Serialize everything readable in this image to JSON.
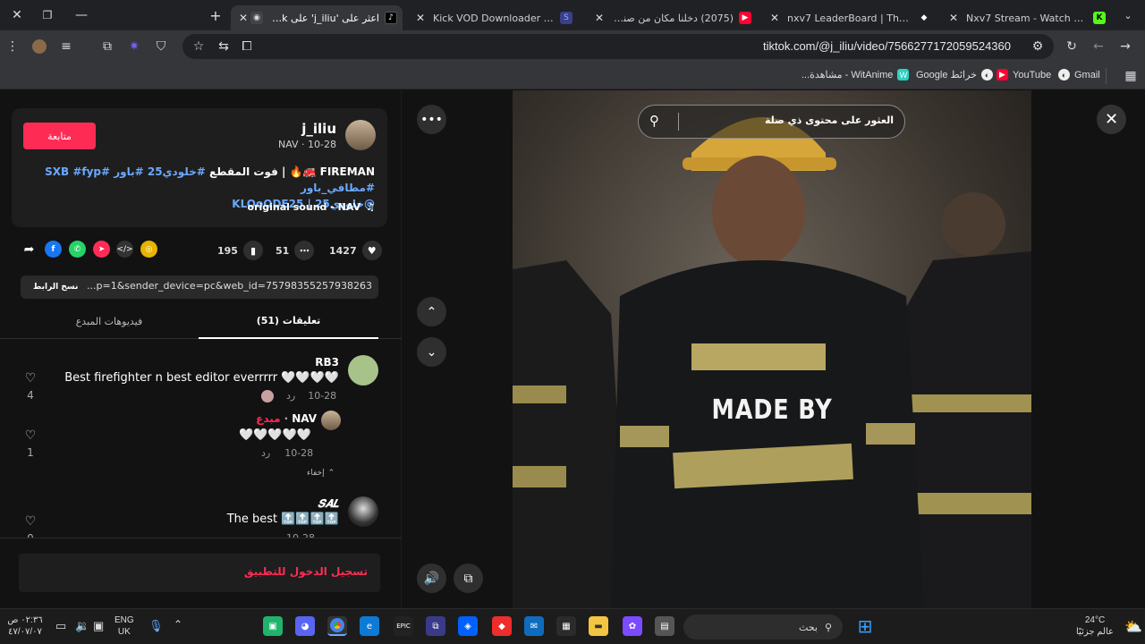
{
  "browser": {
    "window_controls": {
      "close": "✕",
      "restore": "❐",
      "minimize": "—"
    },
    "new_tab": "+",
    "tabs": [
      {
        "title": "اعثر على 'j_iliu' على TikTok",
        "icon": "tiktok-icon",
        "active": true
      },
      {
        "title": "Kick VOD Downloader - Stream",
        "icon": "kick-icon",
        "active": false
      },
      {
        "title": "(2075) دخلنا مكان من صنع الخالق",
        "icon": "youtube-icon",
        "active": false
      },
      {
        "title": "nxv7 LeaderBoard | The best Ch",
        "icon": "diamond-icon",
        "active": false
      },
      {
        "title": "Nxv7 Stream - Watch Live on K",
        "icon": "kick-icon",
        "active": false
      }
    ],
    "url": "tiktok.com/@j_iliu/video/7566277172059524360",
    "bookmarks": [
      {
        "label": "Gmail",
        "icon": "gmail-icon"
      },
      {
        "label": "YouTube",
        "icon": "youtube-icon"
      },
      {
        "label": "خرائط Google",
        "icon": "maps-icon"
      },
      {
        "label": "WitAnime - مشاهدة...",
        "icon": "witanime-icon"
      }
    ]
  },
  "post": {
    "follow_label": "متابعة",
    "username": "j_iliu",
    "meta": "NAV · 10-28",
    "caption_line1_white": "FIREMAN 🚒🔥 | فوت المقطع",
    "caption_line1_tags": "#خلودي25 #باور #SXB #fyp #مطافي_باور",
    "caption_line2": "@خلودي25 | KLOoODE25",
    "sound": "original sound - NAV",
    "stats": {
      "likes": "1427",
      "comments": "51",
      "saves": "195"
    },
    "link_text": "...p=1&sender_device=pc&web_id=7579835525793826311",
    "copy_link_label": "نسخ الرابط",
    "tabs": {
      "comments": "تعليقات (51)",
      "creator_videos": "فيديوهات المبدع"
    }
  },
  "comments": [
    {
      "user": "RB3",
      "text": "Best firefighter n best editor everrrrr 🤍🤍🤍🤍",
      "date": "10-28",
      "reply_label": "رد",
      "likes": "4"
    },
    {
      "user": "NAV",
      "creator_badge": "مبدع",
      "text": "🤍🤍🤍🤍🤍",
      "date": "10-28",
      "reply_label": "رد",
      "likes": "1",
      "hide_label": "إخفاء"
    },
    {
      "user": "𝑺𝑨𝑳",
      "text": "The best 🔝🔝🔝🔝",
      "date": "10-28",
      "likes": "0"
    }
  ],
  "login_label": "تسجيل الدخول للتطبيق",
  "video": {
    "search_placeholder": "العثور على محتوى ذي صلة",
    "overlay_text": "MADE BY"
  },
  "taskbar": {
    "search_label": "بحث",
    "lang": "ENG",
    "lang_sub": "UK",
    "time": "٠٢:٣٦ ص",
    "date": "٤٧/٠٧/٠٧",
    "weather_temp": "24°C",
    "weather_label": "عالم جزئيًا"
  }
}
